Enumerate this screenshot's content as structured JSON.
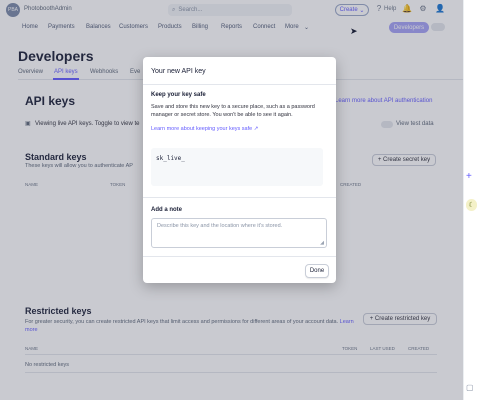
{
  "topbar": {
    "account_name": "PhotoboothAdmin",
    "logo_text": "PBA",
    "search_placeholder": "Search...",
    "create_label": "Create",
    "help_label": "Help"
  },
  "nav": {
    "items": [
      "Home",
      "Payments",
      "Balances",
      "Customers",
      "Products",
      "Billing",
      "Reports",
      "Connect",
      "More"
    ],
    "developers_label": "Developers"
  },
  "page": {
    "title": "Developers",
    "tabs": [
      "Overview",
      "API keys",
      "Webhooks",
      "Eve"
    ],
    "section_title": "API keys",
    "learn_more": "Learn more about API authentication",
    "viewing_text": "Viewing live API keys. Toggle to view te",
    "view_test_data": "View test data"
  },
  "standard_keys": {
    "title": "Standard keys",
    "subtitle": "These keys will allow you to authenticate AP",
    "create_button": "+ Create secret key",
    "columns": [
      "NAME",
      "TOKEN",
      "CREATED"
    ]
  },
  "restricted_keys": {
    "title": "Restricted keys",
    "subtitle": "For greater security, you can create restricted API keys that limit access and permissions for different areas of your account data.",
    "learn_more": "Learn more",
    "create_button": "+ Create restricted key",
    "columns": [
      "NAME",
      "TOKEN",
      "LAST USED",
      "CREATED"
    ],
    "empty": "No restricted keys"
  },
  "modal": {
    "title": "Your new API key",
    "section_title": "Keep your key safe",
    "description": "Save and store this new key to a secure place, such as a password manager or secret store. You won't be able to see it again.",
    "learn_more": "Learn more about keeping your keys safe",
    "key_value": "sk_live_",
    "note_title": "Add a note",
    "note_placeholder": "Describe this key and the location where it's stored.",
    "done_label": "Done"
  },
  "colors": {
    "accent": "#635bff",
    "overlay": "#3c4257"
  }
}
